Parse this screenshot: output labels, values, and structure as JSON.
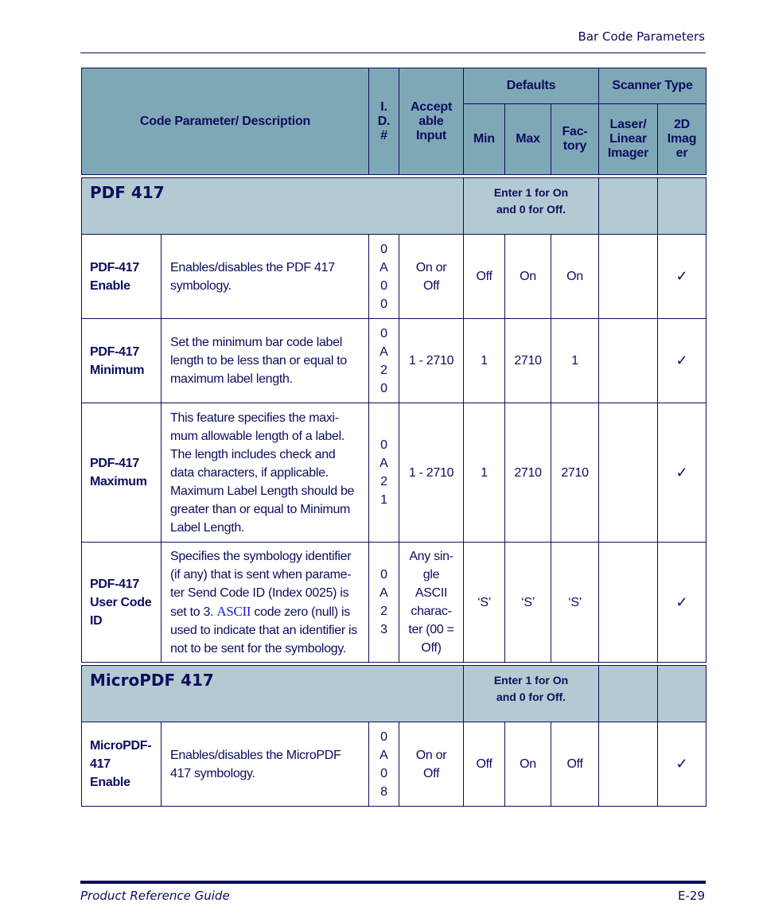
{
  "header": {
    "running_title": "Bar Code Parameters"
  },
  "table": {
    "columns": {
      "code_param": "Code Parameter/ Description",
      "id": [
        "I.",
        "D.",
        "#"
      ],
      "accept": [
        "Accept",
        "able",
        "Input"
      ],
      "defaults": "Defaults",
      "scanner_type": "Scanner Type",
      "min": "Min",
      "max": "Max",
      "factory": [
        "Fac-",
        "tory"
      ],
      "laser": [
        "Laser/",
        "Linear",
        "Imager"
      ],
      "imager2d": [
        "2D",
        "Imag",
        "er"
      ]
    },
    "sections": [
      {
        "title": "PDF 417",
        "note": [
          "Enter 1 for On",
          "and 0 for Off."
        ],
        "rows": [
          {
            "name": [
              "PDF-417",
              "Enable"
            ],
            "description": "Enables/disables the PDF 417 symbology.",
            "id": [
              "0",
              "A",
              "0",
              "0"
            ],
            "accept": [
              "On or",
              "Off"
            ],
            "min": "Off",
            "max": "On",
            "factory": "On",
            "laser": "",
            "imager2d": "✓"
          },
          {
            "name": [
              "PDF-417",
              "Minimum"
            ],
            "description": "Set the minimum bar code label length to be less than or equal to maximum label length.",
            "id": [
              "0",
              "A",
              "2",
              "0"
            ],
            "accept": [
              "1 - 2710"
            ],
            "min": "1",
            "max": "2710",
            "factory": "1",
            "laser": "",
            "imager2d": "✓"
          },
          {
            "name": [
              "PDF-417",
              "Maximum"
            ],
            "description": "This feature specifies the maxi-mum allowable length of a label. The length includes check and data characters, if applicable. Maximum Label Length should be greater than or equal to Minimum Label Length.",
            "id": [
              "0",
              "A",
              "2",
              "1"
            ],
            "accept": [
              "1 - 2710"
            ],
            "min": "1",
            "max": "2710",
            "factory": "2710",
            "laser": "",
            "imager2d": "✓"
          },
          {
            "name": [
              "PDF-417",
              "User Code",
              "ID"
            ],
            "description_pre": "Specifies the symbology identifier (if any) that is sent when parame-ter Send Code ID (Index 0025) is set to 3. ",
            "description_ascii": "ASCII",
            "description_post": " code zero (null) is used to indicate that an identifier is not to be sent for the symbology.",
            "id": [
              "0",
              "A",
              "2",
              "3"
            ],
            "accept": [
              "Any sin-",
              "gle",
              "ASCII",
              "charac-",
              "ter (00 =",
              "Off)"
            ],
            "min": "‘S’",
            "max": "‘S’",
            "factory": "‘S’",
            "laser": "",
            "imager2d": "✓"
          }
        ]
      },
      {
        "title": "MicroPDF 417",
        "note": [
          "Enter 1 for On",
          "and 0 for Off."
        ],
        "rows": [
          {
            "name": [
              "MicroPDF-",
              "417",
              "Enable"
            ],
            "description": "Enables/disables the MicroPDF 417 symbology.",
            "id": [
              "0",
              "A",
              "0",
              "8"
            ],
            "accept": [
              "On or",
              "Off"
            ],
            "min": "Off",
            "max": "On",
            "factory": "Off",
            "laser": "",
            "imager2d": "✓"
          }
        ]
      }
    ]
  },
  "footer": {
    "guide_title": "Product Reference Guide",
    "page_number": "E-29"
  }
}
